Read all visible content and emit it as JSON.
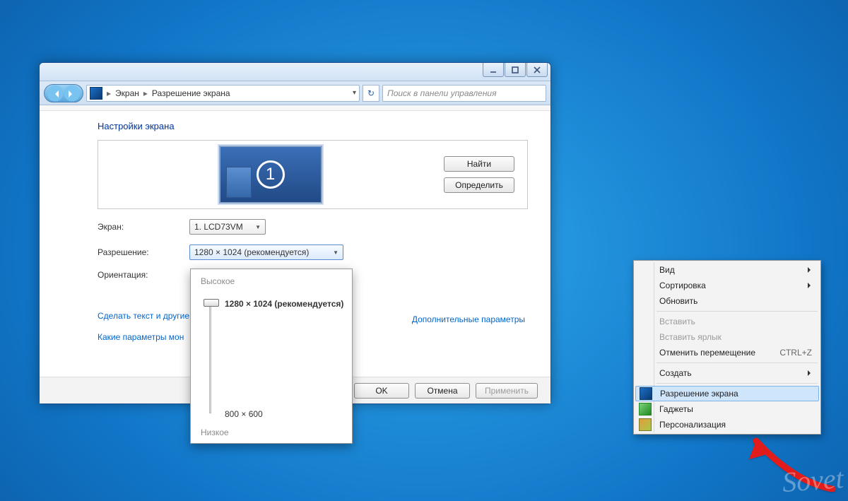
{
  "breadcrumb": {
    "root": "Экран",
    "current": "Разрешение экрана"
  },
  "search": {
    "placeholder": "Поиск в панели управления"
  },
  "heading": "Настройки экрана",
  "monitor": {
    "number": "1"
  },
  "side_buttons": {
    "find": "Найти",
    "identify": "Определить"
  },
  "form": {
    "screen_label": "Экран:",
    "screen_value": "1. LCD73VM",
    "resolution_label": "Разрешение:",
    "resolution_value": "1280 × 1024 (рекомендуется)",
    "orientation_label": "Ориентация:"
  },
  "links": {
    "advanced": "Дополнительные параметры",
    "text_size": "Сделать текст и другие",
    "projector": "Какие параметры мон"
  },
  "footer": {
    "ok": "OK",
    "cancel": "Отмена",
    "apply": "Применить"
  },
  "slider": {
    "high": "Высокое",
    "top_value": "1280 × 1024 (рекомендуется)",
    "bottom_value": "800 × 600",
    "low": "Низкое"
  },
  "context_menu": {
    "view": "Вид",
    "sort": "Сортировка",
    "refresh": "Обновить",
    "paste": "Вставить",
    "paste_shortcut": "Вставить ярлык",
    "undo_move": "Отменить перемещение",
    "undo_shortcut": "CTRL+Z",
    "create": "Создать",
    "screen_resolution": "Разрешение экрана",
    "gadgets": "Гаджеты",
    "personalize": "Персонализация"
  },
  "watermark": "Sovet"
}
